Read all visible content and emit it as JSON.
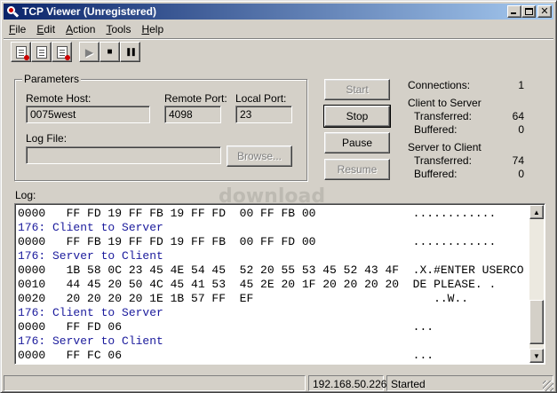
{
  "window": {
    "title": "TCP Viewer (Unregistered)"
  },
  "menu": [
    {
      "prefix": "",
      "mnemonic": "F",
      "rest": "ile"
    },
    {
      "prefix": "",
      "mnemonic": "E",
      "rest": "dit"
    },
    {
      "prefix": "",
      "mnemonic": "A",
      "rest": "ction"
    },
    {
      "prefix": "",
      "mnemonic": "T",
      "rest": "ools"
    },
    {
      "prefix": "",
      "mnemonic": "H",
      "rest": "elp"
    }
  ],
  "toolbar": {
    "play_glyph": "▶",
    "stop_glyph": "■",
    "pause_glyph": "❚❚"
  },
  "parameters": {
    "title": "Parameters",
    "remote_host_label": "Remote Host:",
    "remote_host_value": "0075west",
    "remote_port_label": "Remote Port:",
    "remote_port_value": "4098",
    "local_port_label": "Local Port:",
    "local_port_value": "23",
    "log_file_label": "Log File:",
    "log_file_value": "",
    "browse_label": "Browse..."
  },
  "buttons": {
    "start": "Start",
    "stop": "Stop",
    "pause": "Pause",
    "resume": "Resume"
  },
  "stats": {
    "connections_label": "Connections:",
    "connections_value": "1",
    "c2s_label": "Client to Server",
    "c2s_transferred_label": "Transferred:",
    "c2s_transferred_value": "64",
    "c2s_buffered_label": "Buffered:",
    "c2s_buffered_value": "0",
    "s2c_label": "Server to Client",
    "s2c_transferred_label": "Transferred:",
    "s2c_transferred_value": "74",
    "s2c_buffered_label": "Buffered:",
    "s2c_buffered_value": "0"
  },
  "log": {
    "label": "Log:",
    "lines": [
      {
        "type": "data",
        "text": "0000   FF FD 19 FF FB 19 FF FD  00 FF FB 00              ............"
      },
      {
        "type": "header",
        "text": "176: Client to Server"
      },
      {
        "type": "data",
        "text": "0000   FF FB 19 FF FD 19 FF FB  00 FF FD 00              ............"
      },
      {
        "type": "header",
        "text": "176: Server to Client"
      },
      {
        "type": "data",
        "text": "0000   1B 58 0C 23 45 4E 54 45  52 20 55 53 45 52 43 4F  .X.#ENTER USERCO"
      },
      {
        "type": "data",
        "text": "0010   44 45 20 50 4C 45 41 53  45 2E 20 1F 20 20 20 20  DE PLEASE. ."
      },
      {
        "type": "data",
        "text": "0020   20 20 20 20 1E 1B 57 FF  EF                          ..W.."
      },
      {
        "type": "header",
        "text": "176: Client to Server"
      },
      {
        "type": "data",
        "text": "0000   FF FD 06                                          ..."
      },
      {
        "type": "header",
        "text": "176: Server to Client"
      },
      {
        "type": "data",
        "text": "0000   FF FC 06                                          ..."
      }
    ]
  },
  "status": {
    "pane1": "",
    "address": "192.168.50.226",
    "state": "Started"
  },
  "watermark": "download"
}
